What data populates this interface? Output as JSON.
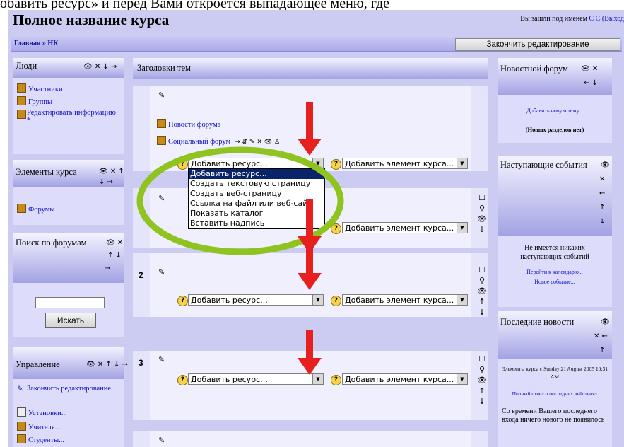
{
  "caption_top": "обавить ресурс» и перед Вами откроется выпадающее меню, где",
  "header": {
    "course_title": "Полное название курса",
    "logged_in_text": "Вы зашли под именем",
    "user_link": "С С",
    "logout": "(Выход"
  },
  "navbar": {
    "home": "Главная",
    "sep": "»",
    "current": "НК",
    "finish_edit_button": "Закончить редактирование"
  },
  "left_blocks": {
    "people": {
      "title": "Люди",
      "items": [
        "Участники",
        "Группы",
        "Редактировать информацию *"
      ]
    },
    "activities": {
      "title": "Элементы курса",
      "items": [
        "Форумы"
      ]
    },
    "search": {
      "title": "Поиск по форумам",
      "button": "Искать",
      "input_value": ""
    },
    "admin": {
      "title": "Управление",
      "items": [
        "Закончить редактирование",
        "Установки...",
        "Учителя...",
        "Студенты..."
      ]
    }
  },
  "center": {
    "topics_header": "Заголовки тем",
    "section0_items": [
      "Новости форума",
      "Социальный форум"
    ],
    "add_resource": "Добавить ресурс...",
    "add_activity": "Добавить элемент курса...",
    "section_numbers": [
      "2",
      "3"
    ],
    "dropdown_options": [
      "Добавить ресурс...",
      "Создать текстовую страницу",
      "Создать веб-страницу",
      "Ссылка на файл или веб-сайт",
      "Показать каталог",
      "Вставить надпись"
    ]
  },
  "right_blocks": {
    "news_forum": {
      "title": "Новостной форум",
      "add_topic": "Добавить новую тему...",
      "no_topics": "(Новых разделов нет)"
    },
    "upcoming": {
      "title": "Наступающие события",
      "none": "Не имеется никаких наступающих событий",
      "goto_calendar": "Перейти к календарю...",
      "new_event": "Новое событие..."
    },
    "latest_news": {
      "title": "Последние новости",
      "activity_line": "Элементы курса с Sunday 21 August 2005 10:31 AM",
      "full_report": "Полный отчет о последних действиях",
      "since_last": "Со времени Вашего последнего входа ничего нового не появилось"
    }
  },
  "colors": {
    "annotation_arrow": "#e81f1f",
    "annotation_ellipse": "#8fc31f",
    "page_bg": "#ccccf3"
  }
}
